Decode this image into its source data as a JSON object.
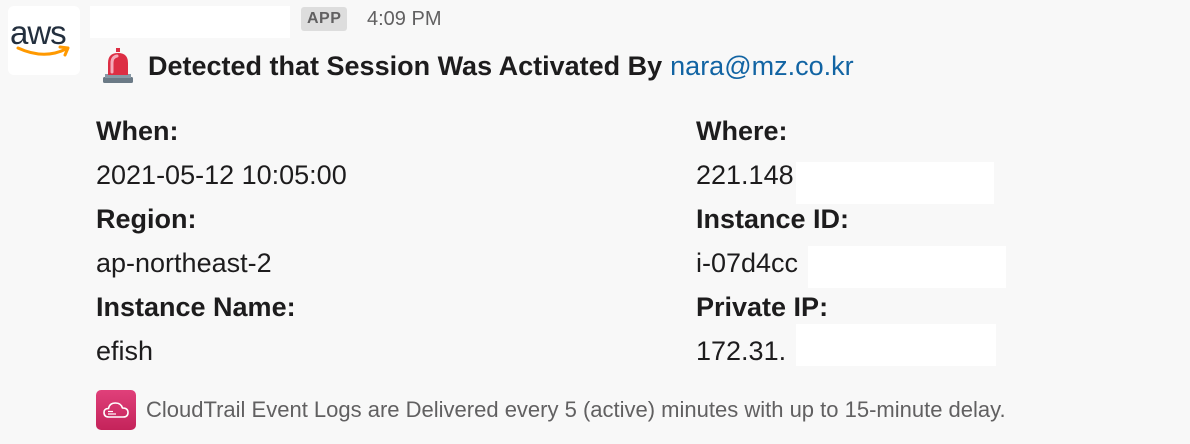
{
  "app": {
    "logo_text": "aws",
    "badge": "APP",
    "timestamp": "4:09 PM"
  },
  "message": {
    "title": "Detected that Session Was Activated By",
    "user_link": "nara@mz.co.kr",
    "title_icon": "rotating-light-icon",
    "fields": {
      "when_label": "When:",
      "when_value": "2021-05-12 10:05:00",
      "where_label": "Where:",
      "where_value": "221.148",
      "region_label": "Region:",
      "region_value": "ap-northeast-2",
      "instance_id_label": "Instance ID:",
      "instance_id_value": "i-07d4cc",
      "instance_name_label": "Instance Name:",
      "instance_name_value": "efish",
      "private_ip_label": "Private IP:",
      "private_ip_value": "172.31."
    },
    "footer": {
      "icon": "cloudtrail-icon",
      "text": "CloudTrail Event Logs are Delivered every 5 (active) minutes with up to 15-minute delay."
    }
  },
  "colors": {
    "link": "#1264a3",
    "footer_icon": "#d6336c",
    "aws_orange": "#ff9900"
  }
}
